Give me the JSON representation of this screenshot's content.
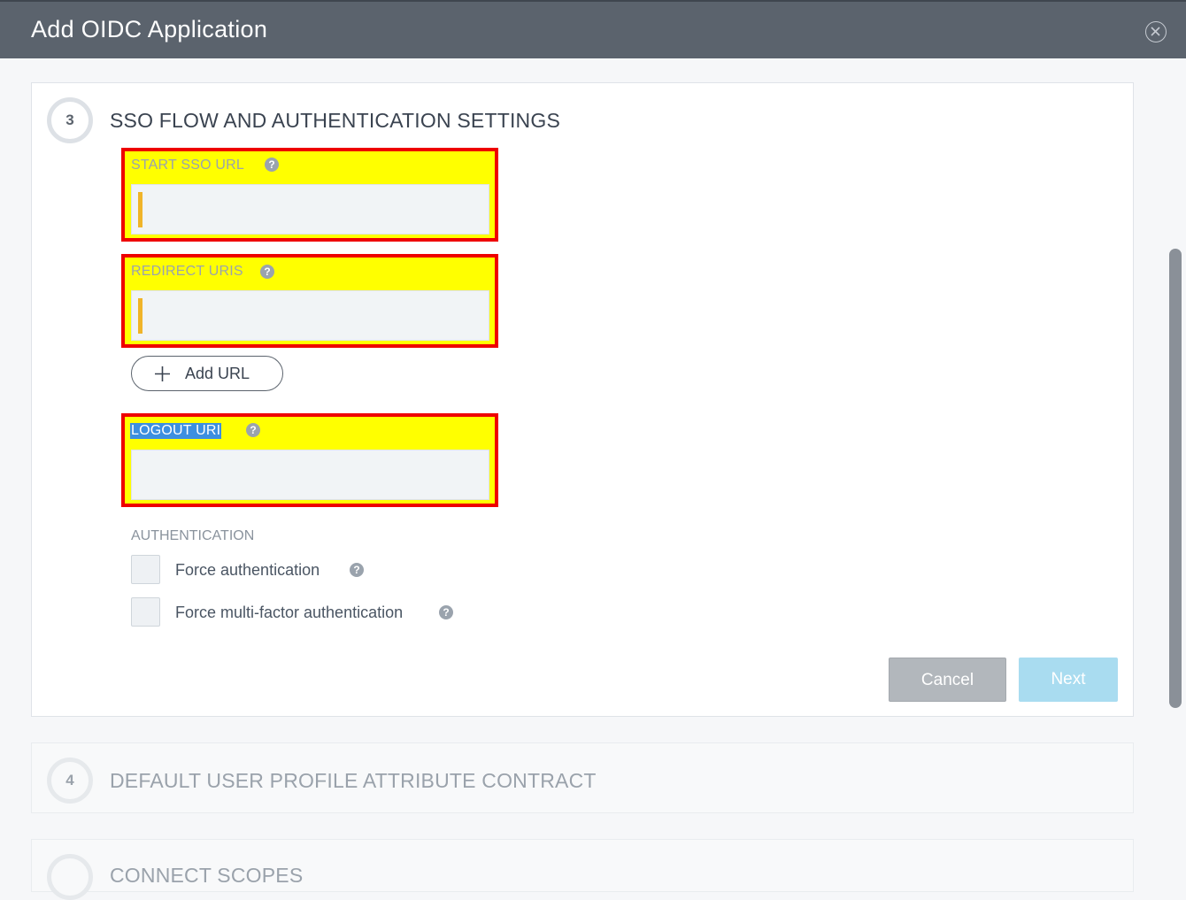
{
  "dialog": {
    "title": "Add OIDC Application"
  },
  "step3": {
    "number": "3",
    "title": "SSO FLOW AND AUTHENTICATION SETTINGS",
    "start_sso_url": {
      "label": "START SSO URL",
      "value": "",
      "help": "?"
    },
    "redirect_uris": {
      "label": "REDIRECT URIS",
      "value": "",
      "help": "?"
    },
    "add_url_label": "Add URL",
    "logout_uri": {
      "label": "LOGOUT URI",
      "value": "",
      "help": "?"
    },
    "authentication": {
      "header": "AUTHENTICATION",
      "options": [
        {
          "label": "Force authentication",
          "checked": false,
          "help": "?"
        },
        {
          "label": "Force multi-factor authentication",
          "checked": false,
          "help": "?"
        }
      ]
    },
    "cancel_label": "Cancel",
    "next_label": "Next"
  },
  "step4": {
    "number": "4",
    "title": "DEFAULT USER PROFILE ATTRIBUTE CONTRACT"
  },
  "step5": {
    "number": "",
    "title": "CONNECT SCOPES"
  },
  "colors": {
    "header_bg": "#5b636d",
    "highlight_fill": "#ffff00",
    "highlight_border": "#ee0000",
    "required_marker": "#f0b429",
    "next_button": "#a9dcf0",
    "cancel_button": "#b2b7bc"
  }
}
